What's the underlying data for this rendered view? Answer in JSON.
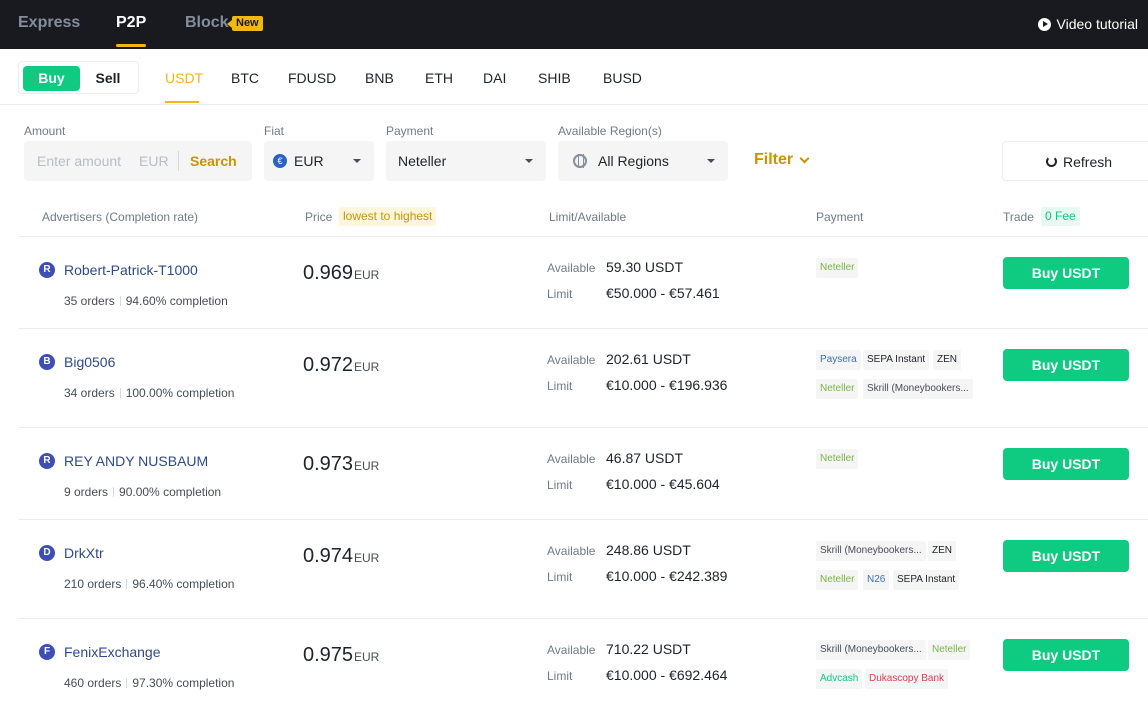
{
  "topbar": {
    "express": "Express",
    "p2p": "P2P",
    "block": "Block",
    "new_badge": "New",
    "video_tutorial": "Video tutorial"
  },
  "trade_toggle": {
    "buy": "Buy",
    "sell": "Sell"
  },
  "assets": [
    "USDT",
    "BTC",
    "FDUSD",
    "BNB",
    "ETH",
    "DAI",
    "SHIB",
    "BUSD"
  ],
  "active_asset": "USDT",
  "filters": {
    "amount_label": "Amount",
    "amount_placeholder": "Enter amount",
    "amount_currency": "EUR",
    "search": "Search",
    "fiat_label": "Fiat",
    "fiat_value": "EUR",
    "fiat_icon": "€",
    "payment_label": "Payment",
    "payment_value": "Neteller",
    "region_label": "Available Region(s)",
    "region_value": "All Regions",
    "filter": "Filter",
    "refresh": "Refresh"
  },
  "table_header": {
    "advertisers": "Advertisers (Completion rate)",
    "price": "Price",
    "price_sort": "lowest to highest",
    "limit": "Limit/Available",
    "payment": "Payment",
    "trade": "Trade",
    "fee": "0 Fee"
  },
  "labels": {
    "available": "Available",
    "limit": "Limit"
  },
  "colors": {
    "accent": "#f0b90b",
    "buy_green": "#0ecb81",
    "topbar": "#181a20"
  },
  "offers": [
    {
      "initial": "R",
      "name": "Robert-Patrick-T1000",
      "orders": "35 orders",
      "completion": "94.60% completion",
      "price": "0.969",
      "currency": "EUR",
      "available": "59.30 USDT",
      "limit": "€50.000 - €57.461",
      "payments": [
        [
          "Neteller"
        ]
      ],
      "action": "Buy USDT"
    },
    {
      "initial": "B",
      "name": "Big0506",
      "orders": "34 orders",
      "completion": "100.00% completion",
      "price": "0.972",
      "currency": "EUR",
      "available": "202.61 USDT",
      "limit": "€10.000 - €196.936",
      "payments": [
        [
          "Paysera",
          "SEPA Instant",
          "ZEN"
        ],
        [
          "Neteller",
          "Skrill (Moneybookers..."
        ]
      ],
      "action": "Buy USDT"
    },
    {
      "initial": "R",
      "name": "REY ANDY NUSBAUM",
      "orders": "9 orders",
      "completion": "90.00% completion",
      "price": "0.973",
      "currency": "EUR",
      "available": "46.87 USDT",
      "limit": "€10.000 - €45.604",
      "payments": [
        [
          "Neteller"
        ]
      ],
      "action": "Buy USDT"
    },
    {
      "initial": "D",
      "name": "DrkXtr",
      "orders": "210 orders",
      "completion": "96.40% completion",
      "price": "0.974",
      "currency": "EUR",
      "available": "248.86 USDT",
      "limit": "€10.000 - €242.389",
      "payments": [
        [
          "Skrill (Moneybookers...",
          "ZEN"
        ],
        [
          "Neteller",
          "N26",
          "SEPA Instant"
        ]
      ],
      "action": "Buy USDT"
    },
    {
      "initial": "F",
      "name": "FenixExchange",
      "orders": "460 orders",
      "completion": "97.30% completion",
      "price": "0.975",
      "currency": "EUR",
      "available": "710.22 USDT",
      "limit": "€10.000 - €692.464",
      "payments": [
        [
          "Skrill (Moneybookers...",
          "Neteller"
        ],
        [
          "Advcash",
          "Dukascopy Bank"
        ]
      ],
      "action": "Buy USDT"
    }
  ]
}
